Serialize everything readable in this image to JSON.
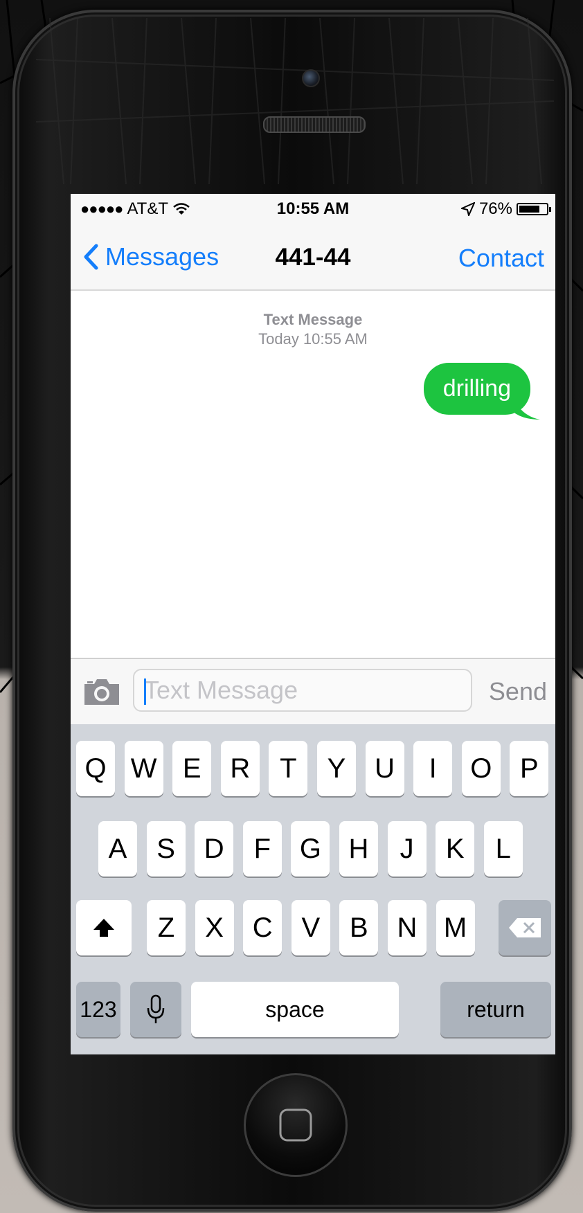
{
  "status_bar": {
    "carrier": "AT&T",
    "time": "10:55 AM",
    "battery_percent": "76%",
    "battery_level": 0.76
  },
  "nav": {
    "back_label": "Messages",
    "title": "441-44",
    "contact_label": "Contact"
  },
  "thread": {
    "header_type": "Text Message",
    "header_time": "Today 10:55 AM",
    "messages": [
      {
        "text": "drilling",
        "direction": "sent"
      }
    ]
  },
  "composer": {
    "placeholder": "Text Message",
    "send_label": "Send"
  },
  "keyboard": {
    "row1": [
      "Q",
      "W",
      "E",
      "R",
      "T",
      "Y",
      "U",
      "I",
      "O",
      "P"
    ],
    "row2": [
      "A",
      "S",
      "D",
      "F",
      "G",
      "H",
      "J",
      "K",
      "L"
    ],
    "row3": [
      "Z",
      "X",
      "C",
      "V",
      "B",
      "N",
      "M"
    ],
    "numbers_label": "123",
    "space_label": "space",
    "return_label": "return"
  },
  "icons": [
    "chevron-left-icon",
    "camera-icon",
    "wifi-icon",
    "location-arrow-icon",
    "battery-icon",
    "shift-icon",
    "delete-icon",
    "microphone-icon",
    "home-button-icon"
  ],
  "colors": {
    "accent": "#147efb",
    "bubble": "#1dc440",
    "keyboard_bg": "#d1d5db"
  }
}
